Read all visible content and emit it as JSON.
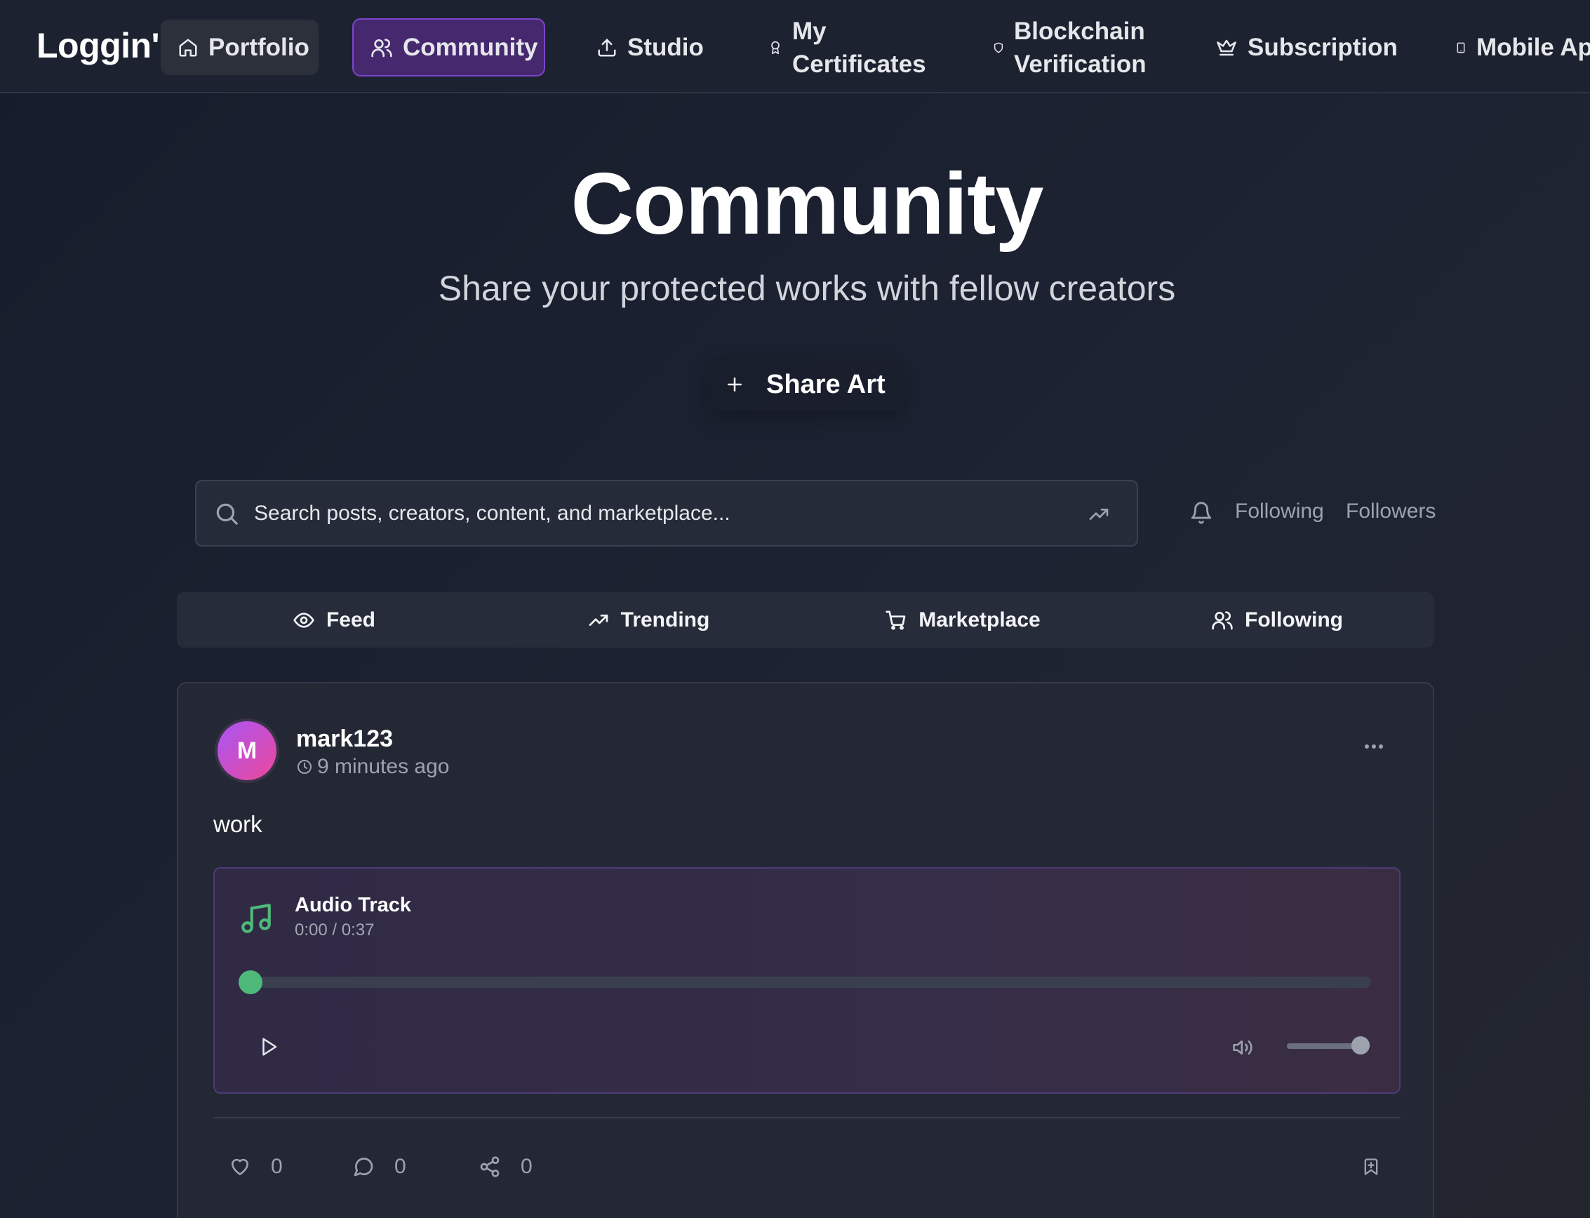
{
  "nav": {
    "logo": "Loggin'",
    "items": [
      {
        "label": "Portfolio",
        "icon": "home-icon"
      },
      {
        "label": "Community",
        "icon": "users-icon",
        "active": true
      },
      {
        "label": "Studio",
        "icon": "upload-icon"
      },
      {
        "label": "My Certificates",
        "icon": "award-icon"
      },
      {
        "label": "Blockchain Verification",
        "icon": "shield-icon"
      },
      {
        "label": "Subscription",
        "icon": "crown-icon"
      },
      {
        "label": "Mobile App",
        "icon": "smartphone-icon"
      }
    ]
  },
  "hero": {
    "title": "Community",
    "subtitle": "Share your protected works with fellow creators",
    "share_button": "Share Art"
  },
  "search": {
    "placeholder": "Search posts, creators, content, and marketplace..."
  },
  "social_links": {
    "following": "Following",
    "followers": "Followers"
  },
  "tabs": [
    {
      "label": "Feed",
      "icon": "eye-icon"
    },
    {
      "label": "Trending",
      "icon": "trending-up-icon"
    },
    {
      "label": "Marketplace",
      "icon": "shopping-cart-icon"
    },
    {
      "label": "Following",
      "icon": "users-icon"
    }
  ],
  "post": {
    "avatar_initial": "M",
    "username": "mark123",
    "time_ago": "9 minutes ago",
    "text": "work",
    "audio": {
      "title": "Audio Track",
      "time": "0:00 / 0:37",
      "progress": 0.0,
      "volume": 1.0
    },
    "likes": "0",
    "comments": "0",
    "shares": "0"
  },
  "colors": {
    "accent": "#7c45c9",
    "audio_green": "#4fb97a",
    "background": "#1b2030"
  }
}
